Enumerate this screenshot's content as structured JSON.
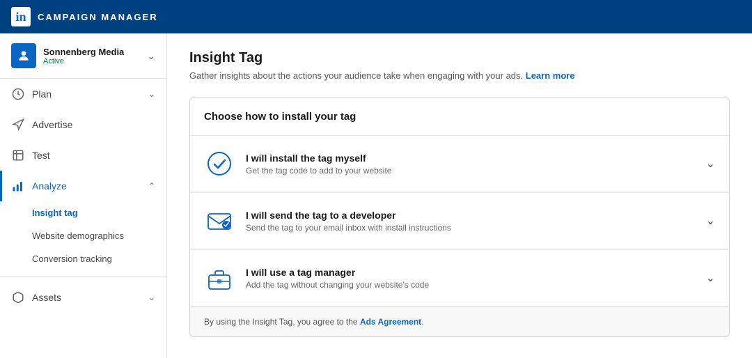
{
  "topNav": {
    "logoText": "in",
    "title": "CAMPAIGN MANAGER"
  },
  "sidebar": {
    "account": {
      "name": "Sonnenberg Media",
      "status": "Active"
    },
    "navItems": [
      {
        "id": "plan",
        "label": "Plan",
        "hasChevron": true
      },
      {
        "id": "advertise",
        "label": "Advertise",
        "hasChevron": false
      },
      {
        "id": "test",
        "label": "Test",
        "hasChevron": false
      },
      {
        "id": "analyze",
        "label": "Analyze",
        "hasChevron": true,
        "active": true
      }
    ],
    "analyzeSubItems": [
      {
        "id": "insight-tag",
        "label": "Insight tag",
        "active": true
      },
      {
        "id": "website-demographics",
        "label": "Website demographics",
        "active": false
      },
      {
        "id": "conversion-tracking",
        "label": "Conversion tracking",
        "active": false
      }
    ],
    "assetsItem": {
      "label": "Assets",
      "hasChevron": true
    }
  },
  "content": {
    "title": "Insight Tag",
    "subtitle": "Gather insights about the actions your audience take when engaging with your ads.",
    "learnMoreLabel": "Learn more",
    "card": {
      "header": "Choose how to install your tag",
      "options": [
        {
          "id": "install-myself",
          "title": "I will install the tag myself",
          "description": "Get the tag code to add to your website",
          "iconType": "check-circle"
        },
        {
          "id": "send-developer",
          "title": "I will send the tag to a developer",
          "description": "Send the tag to your email inbox with install instructions",
          "iconType": "email-tag"
        },
        {
          "id": "tag-manager",
          "title": "I will use a tag manager",
          "description": "Add the tag without changing your website's code",
          "iconType": "briefcase-tag"
        }
      ],
      "footer": {
        "text": "By using the Insight Tag, you agree to the",
        "linkLabel": "Ads Agreement",
        "suffix": "."
      }
    }
  },
  "colors": {
    "brand": "#0a66c2",
    "topNav": "#004182",
    "activeLeft": "#0a66c2",
    "success": "#057642"
  }
}
